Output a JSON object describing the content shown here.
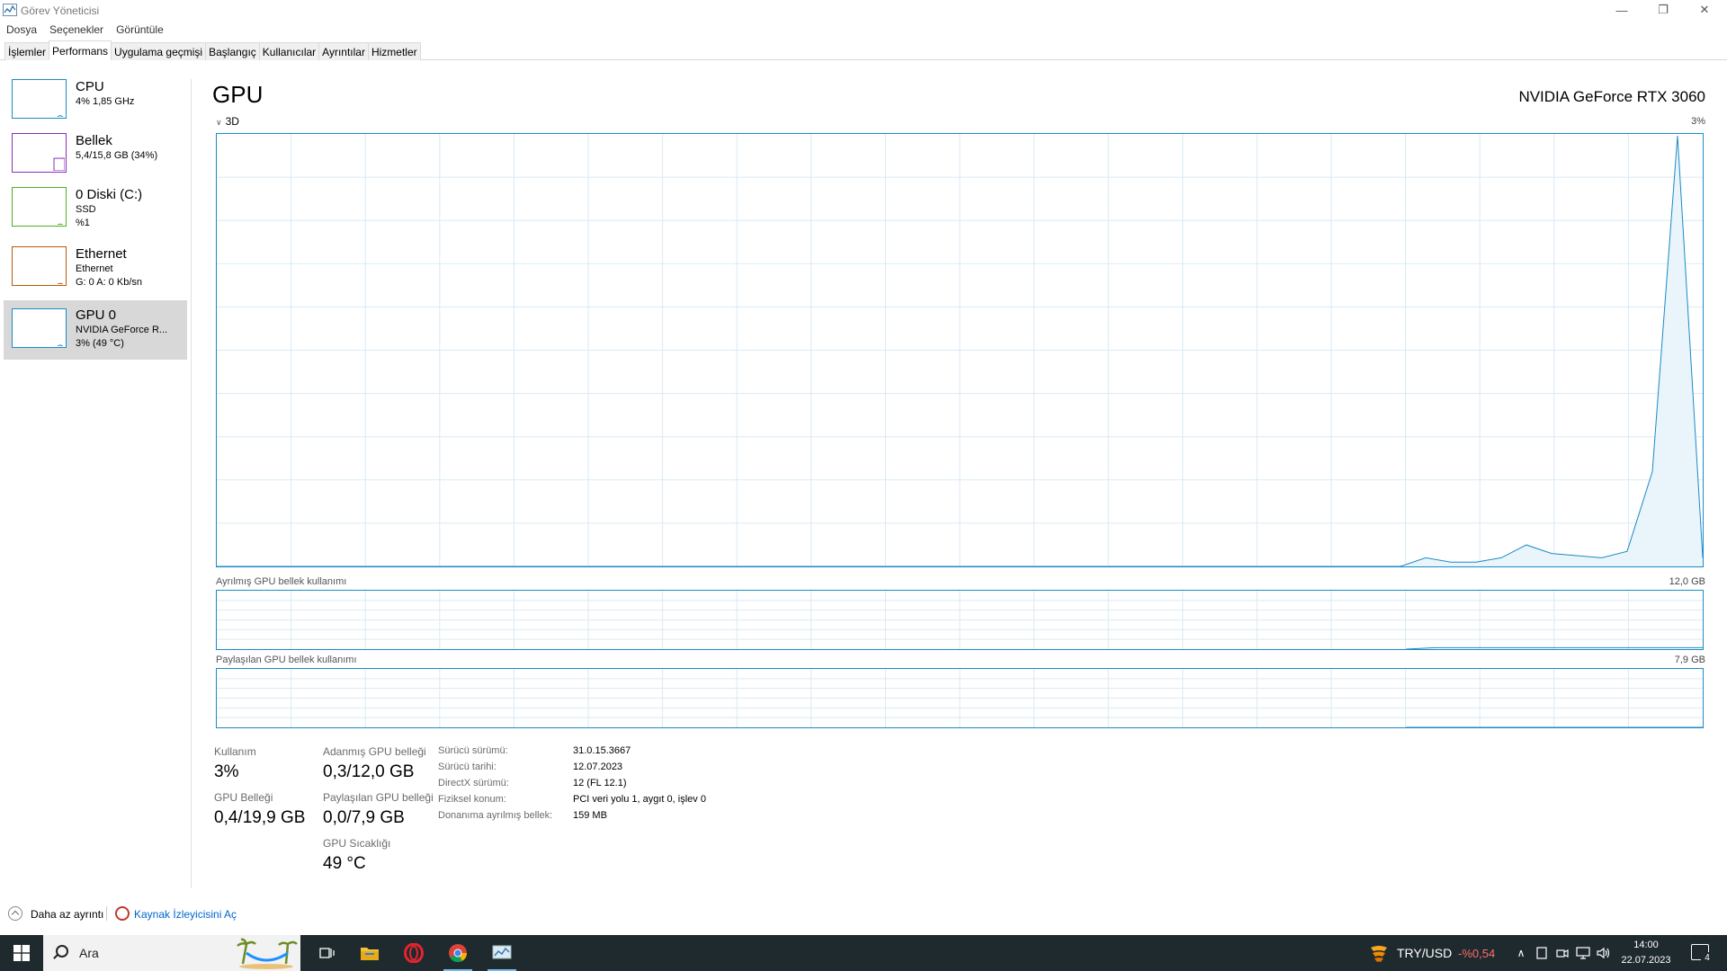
{
  "window": {
    "title": "Görev Yöneticisi",
    "controls": {
      "minimize": "—",
      "maximize": "❐",
      "close": "✕"
    }
  },
  "menu": [
    "Dosya",
    "Seçenekler",
    "Görüntüle"
  ],
  "tabs": [
    {
      "label": "İşlemler",
      "active": false
    },
    {
      "label": "Performans",
      "active": true
    },
    {
      "label": "Uygulama geçmişi",
      "active": false
    },
    {
      "label": "Başlangıç",
      "active": false
    },
    {
      "label": "Kullanıcılar",
      "active": false
    },
    {
      "label": "Ayrıntılar",
      "active": false
    },
    {
      "label": "Hizmetler",
      "active": false
    }
  ],
  "sidebar": [
    {
      "title": "CPU",
      "line1": "4%  1,85 GHz",
      "line2": "",
      "color": "#1a8bc7",
      "level": 0.04
    },
    {
      "title": "Bellek",
      "line1": "5,4/15,8 GB (34%)",
      "line2": "",
      "color": "#8b2eb5",
      "level": 0.34
    },
    {
      "title": "0 Diski (C:)",
      "line1": "SSD",
      "line2": "%1",
      "color": "#4caf21",
      "level": 0.01
    },
    {
      "title": "Ethernet",
      "line1": "Ethernet",
      "line2": "G: 0  A: 0 Kb/sn",
      "color": "#b65a09",
      "level": 0
    },
    {
      "title": "GPU 0",
      "line1": "NVIDIA GeForce R...",
      "line2": "3% (49 °C)",
      "color": "#1a8bc7",
      "level": 0.03,
      "selected": true
    }
  ],
  "main": {
    "title": "GPU",
    "gpu_name": "NVIDIA GeForce RTX 3060",
    "engine_label": "3D",
    "engine_max": "3%",
    "dedicated_label": "Ayrılmış GPU bellek kullanımı",
    "dedicated_max": "12,0 GB",
    "shared_label": "Paylaşılan GPU bellek kullanımı",
    "shared_max": "7,9 GB"
  },
  "chart_data": {
    "type": "area",
    "series": [
      {
        "values": [
          0,
          0,
          0,
          0,
          0,
          0,
          0,
          0,
          0,
          0,
          0,
          0,
          0,
          0,
          0,
          0,
          0,
          0,
          0,
          0,
          0,
          0,
          0,
          0,
          0,
          0,
          0,
          0,
          0,
          0,
          0,
          0,
          0,
          0,
          0,
          0,
          0,
          0,
          0,
          0,
          0,
          0,
          0,
          0,
          0,
          0,
          0,
          0,
          0.02,
          0.01,
          0.01,
          0.02,
          0.05,
          0.03,
          0.025,
          0.02,
          0.035,
          0.22,
          1.0,
          0.02
        ]
      }
    ],
    "ylim": [
      0,
      1
    ]
  },
  "stats": {
    "usage_label": "Kullanım",
    "usage_value": "3%",
    "gpu_mem_label": "GPU Belleği",
    "gpu_mem_value": "0,4/19,9 GB",
    "dedicated_label": "Adanmış GPU belleği",
    "dedicated_value": "0,3/12,0 GB",
    "shared_label": "Paylaşılan GPU belleği",
    "shared_value": "0,0/7,9 GB",
    "temp_label": "GPU Sıcaklığı",
    "temp_value": "49 °C"
  },
  "info": [
    {
      "key": "Sürücü sürümü:",
      "value": "31.0.15.3667"
    },
    {
      "key": "Sürücü tarihi:",
      "value": "12.07.2023"
    },
    {
      "key": "DirectX sürümü:",
      "value": "12 (FL 12.1)"
    },
    {
      "key": "Fiziksel konum:",
      "value": "PCI veri yolu 1, aygıt 0, işlev 0"
    },
    {
      "key": "Donanıma ayrılmış bellek:",
      "value": "159 MB"
    }
  ],
  "footer": {
    "fewer_details": "Daha az ayrıntı",
    "open_resmon": "Kaynak İzleyicisini Aç"
  },
  "taskbar": {
    "search_placeholder": "Ara",
    "ticker_name": "TRY/USD",
    "ticker_change": "-%0,54",
    "time": "14:00",
    "date": "22.07.2023",
    "notifications": "4"
  }
}
